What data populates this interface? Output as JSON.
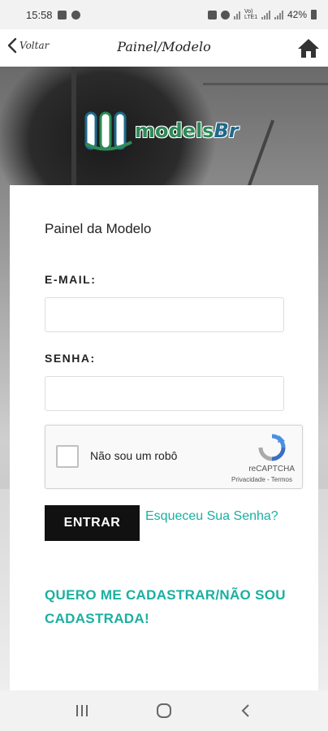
{
  "status_bar": {
    "time": "15:58",
    "battery": "42%",
    "network_label": "Vo) LTE1"
  },
  "nav": {
    "back_label": "Voltar",
    "title": "Painel/Modelo",
    "back_icon": "chevron-left-icon",
    "home_icon": "home-icon"
  },
  "logo": {
    "brand": "models",
    "brand_suffix": "Br"
  },
  "card": {
    "title": "Painel da Modelo",
    "email_label": "E-MAIL:",
    "email_value": "",
    "password_label": "SENHA:",
    "password_value": ""
  },
  "captcha": {
    "label": "Não sou um robô",
    "brand": "reCAPTCHA",
    "links": "Privacidade - Termos"
  },
  "actions": {
    "enter_label": "ENTRAR",
    "forgot_label": "Esqueceu Sua Senha?",
    "register_label": "QUERO ME CADASTRAR/NÃO SOU CADASTRADA!"
  },
  "colors": {
    "accent": "#1ab0a0",
    "button_bg": "#111111",
    "logo_green": "#2e8b57",
    "logo_blue": "#1e6a8a"
  }
}
